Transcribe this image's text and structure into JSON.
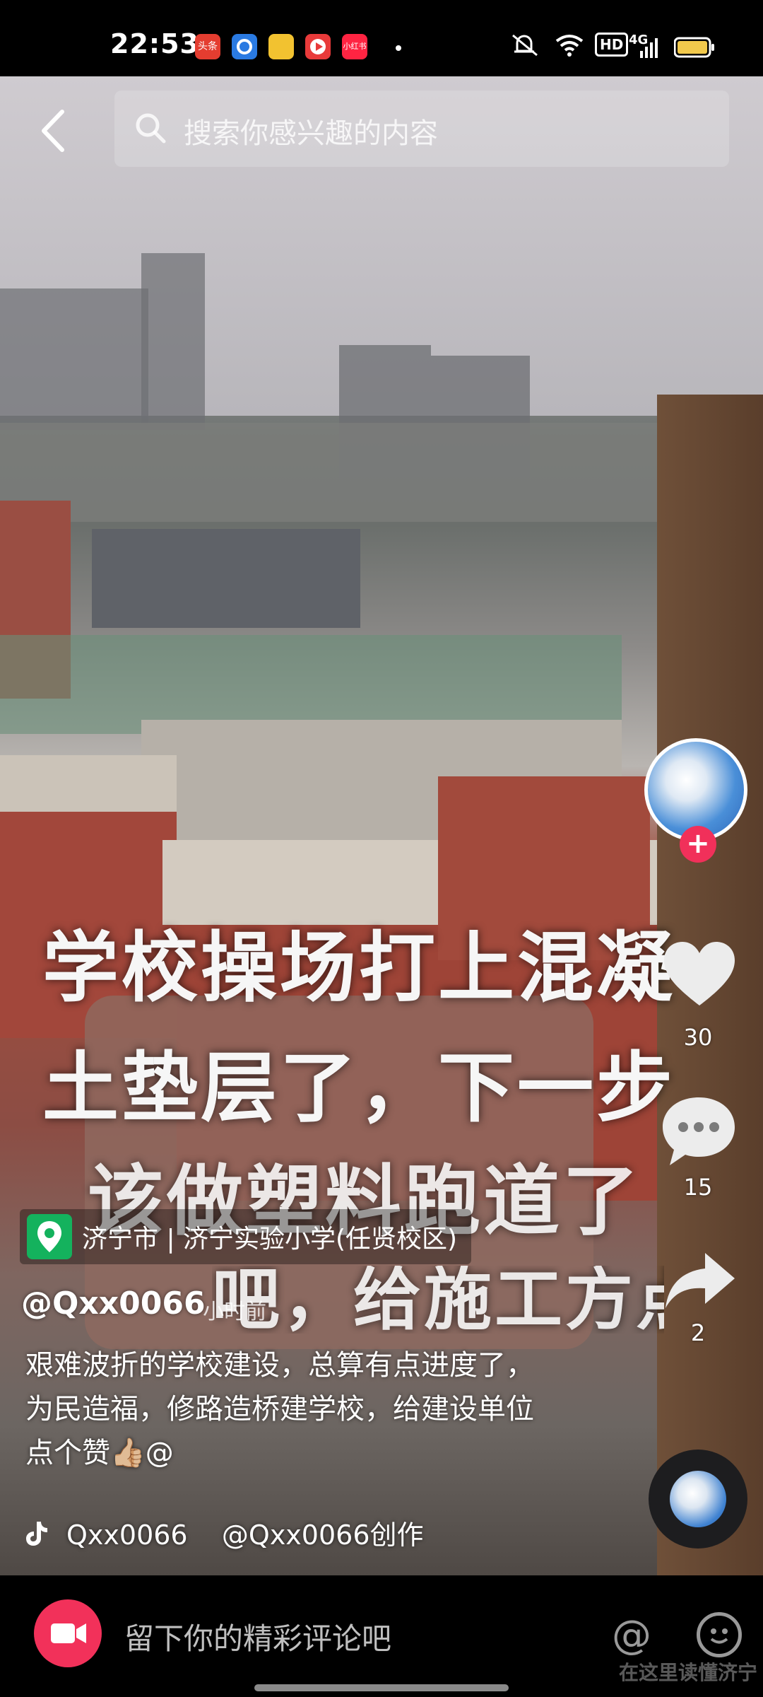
{
  "status_bar": {
    "time": "22:53",
    "app_icons": [
      {
        "name": "toutiao-icon",
        "label": "头条",
        "color": "#e43d30"
      },
      {
        "name": "browser-icon",
        "label": "",
        "color": "#2a7ae2"
      },
      {
        "name": "notes-icon",
        "label": "",
        "color": "#f2c230"
      },
      {
        "name": "video-icon",
        "label": "",
        "color": "#e83a3a"
      },
      {
        "name": "xiaohongshu-icon",
        "label": "小红书",
        "color": "#ff2442"
      }
    ],
    "indicators": [
      "mute-icon",
      "wifi-icon",
      "HD",
      "4G",
      "battery-icon"
    ],
    "hd": "HD",
    "net": "4G"
  },
  "search": {
    "placeholder": "搜索你感兴趣的内容"
  },
  "video_overlay": {
    "lines": [
      "学校操场打上混凝",
      "土垫层了，下一步",
      "该做塑料跑道了",
      "吧，给施工方点赞"
    ]
  },
  "sidebar": {
    "likes": "30",
    "comments": "15",
    "shares": "2"
  },
  "info": {
    "location": "济宁市 | 济宁实验小学(任贤校区)",
    "author": "@Qxx0066",
    "time_ago": "· 小时前",
    "description": "艰难波折的学校建设，总算有点进度了，为民造福，修路造桥建学校，给建设单位点个赞👍🏼@",
    "music": "Qxx0066    @Qxx0066创作"
  },
  "comment_bar": {
    "placeholder": "留下你的精彩评论吧"
  },
  "watermark": "在这里读懂济宁",
  "colors": {
    "accent": "#f2315a",
    "location_green": "#14b25d"
  }
}
